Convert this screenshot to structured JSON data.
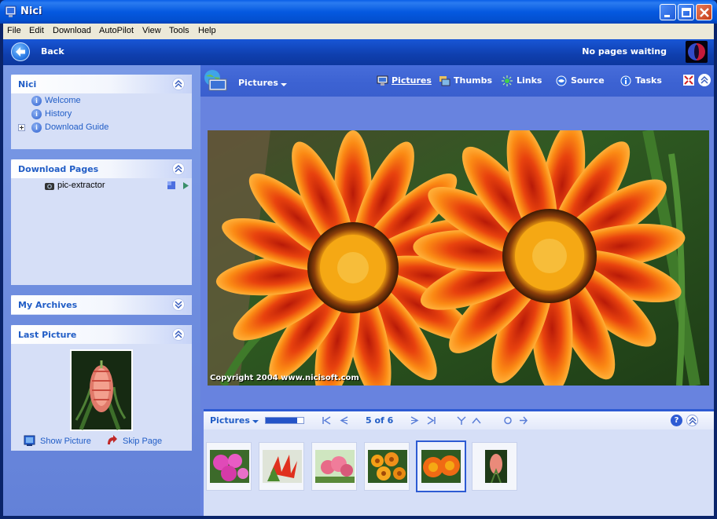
{
  "window": {
    "title": "Nici"
  },
  "menu": {
    "items": [
      "File",
      "Edit",
      "Download",
      "AutoPilot",
      "View",
      "Tools",
      "Help"
    ]
  },
  "nav": {
    "back_label": "Back",
    "queue_status": "No pages waiting"
  },
  "sidebar": {
    "nici": {
      "title": "Nici",
      "links": [
        "Welcome",
        "History",
        "Download Guide"
      ]
    },
    "download_pages": {
      "title": "Download Pages",
      "item": "pic-extractor"
    },
    "archives": {
      "title": "My Archives"
    },
    "last_picture": {
      "title": "Last Picture",
      "show_label": "Show Picture",
      "skip_label": "Skip Page"
    }
  },
  "toolbar": {
    "view_label": "Pictures",
    "tabs": [
      "Pictures",
      "Thumbs",
      "Links",
      "Source",
      "Tasks"
    ]
  },
  "viewer": {
    "copyright": "Copyright 2004 www.nicisoft.com"
  },
  "filmstrip": {
    "title": "Pictures",
    "counter": "5 of 6",
    "progress": 0.83,
    "thumbnails": [
      {
        "subject": "pink flowers",
        "selected": false
      },
      {
        "subject": "red flowers",
        "selected": false
      },
      {
        "subject": "pink blossom cluster",
        "selected": false
      },
      {
        "subject": "orange flowers",
        "selected": false
      },
      {
        "subject": "orange gazanias",
        "selected": true
      },
      {
        "subject": "pink grevillea",
        "selected": false
      }
    ]
  },
  "colors": {
    "accent": "#215dc6",
    "title_bar": "#0559e0",
    "sidebar_bg": "#6f8ee0"
  }
}
